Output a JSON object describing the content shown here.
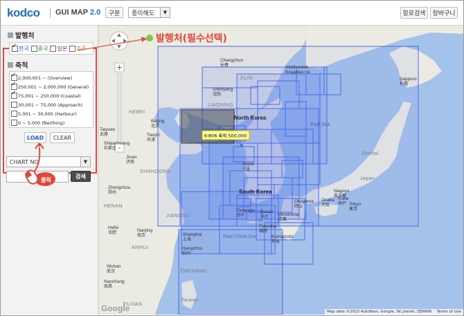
{
  "header": {
    "logo": "kodco",
    "subtitle": "GUI MAP",
    "version": "2.0",
    "category_button": "구분",
    "category_select": "종이해도",
    "route_button": "항로검색",
    "cart_button": "장바구니"
  },
  "left_panel": {
    "publisher_title": "발행처",
    "publishers": [
      {
        "label": "한국",
        "checked": true,
        "color": "#1f5fc7"
      },
      {
        "label": "중국",
        "checked": false,
        "color": "#2a8a2a"
      },
      {
        "label": "일본",
        "checked": false,
        "color": "#8a2a8a"
      },
      {
        "label": "호주",
        "checked": false,
        "color": "#c07a00"
      }
    ],
    "scale_title": "축척",
    "scales": [
      {
        "label": "2,000,001 ~ (Overview)",
        "checked": true
      },
      {
        "label": "250,001 ~ 2,000,000 (General)",
        "checked": true
      },
      {
        "label": "75,001 ~ 250,000 (Coastal)",
        "checked": true
      },
      {
        "label": "30,001 ~ 75,000 (Approach)",
        "checked": false
      },
      {
        "label": "5,001 ~ 30,000 (Harbour)",
        "checked": false
      },
      {
        "label": "0 ~ 5,000 (Berthing)",
        "checked": false
      }
    ],
    "load_button": "LOAD",
    "clear_button": "CLEAR",
    "chart_no_select": "CHART NO",
    "search_button": "검색",
    "click_label": "클릭"
  },
  "map": {
    "callout_label": "발행처(필수선택)",
    "tooltip": "K-806 축척 500,000",
    "attribution": "Map data ©2015 AutoNavi, Google, SK planet, ZENRIN",
    "terms": "Terms of Use",
    "google_logo": "Google",
    "zoom_in": "+",
    "zoom_out": "-",
    "colors": {
      "water": "#a4c2ea",
      "land": "#ecebe3",
      "chart_rect": "#4a6ae8"
    },
    "places": [
      {
        "id": "sapporo",
        "label": "Sapporo",
        "sub": "札幌"
      },
      {
        "id": "vladivostok",
        "label": "Vladivostok",
        "sub": "Владивосток"
      },
      {
        "id": "changchun",
        "label": "Changchun",
        "sub": "长春"
      },
      {
        "id": "jilin",
        "label": "JILIN",
        "sub": ""
      },
      {
        "id": "liaoning",
        "label": "LIAONING",
        "sub": ""
      },
      {
        "id": "shenyang",
        "label": "Shenyang",
        "sub": "沈阳"
      },
      {
        "id": "north_korea",
        "label": "North Korea",
        "sub": ""
      },
      {
        "id": "beijing",
        "label": "Beijing",
        "sub": "北京"
      },
      {
        "id": "tianjin",
        "label": "Tianjin",
        "sub": "天津"
      },
      {
        "id": "jinan",
        "label": "Jinan",
        "sub": "济南"
      },
      {
        "id": "shandong",
        "label": "SHANDONG",
        "sub": ""
      },
      {
        "id": "seoul",
        "label": "Seoul",
        "sub": "서울"
      },
      {
        "id": "south_korea",
        "label": "South Korea",
        "sub": ""
      },
      {
        "id": "gwangju",
        "label": "Gwangju",
        "sub": "광주"
      },
      {
        "id": "busan",
        "label": "Busan",
        "sub": "부산"
      },
      {
        "id": "fukuoka",
        "label": "Fukuoka",
        "sub": "福岡"
      },
      {
        "id": "hiroshima",
        "label": "Hiroshima",
        "sub": "広島"
      },
      {
        "id": "okayama",
        "label": "Okayama",
        "sub": "岡山"
      },
      {
        "id": "osaka",
        "label": "Osaka",
        "sub": "大阪"
      },
      {
        "id": "kobe",
        "label": "Kobe",
        "sub": "神戸"
      },
      {
        "id": "tokyo",
        "label": "Tokyo",
        "sub": "東京"
      },
      {
        "id": "nagoya",
        "label": "Nagoya",
        "sub": "名古屋"
      },
      {
        "id": "kumamoto",
        "label": "Kumamoto",
        "sub": "熊本"
      },
      {
        "id": "sendai",
        "label": "Sendai",
        "sub": ""
      },
      {
        "id": "japan",
        "label": "Japan",
        "sub": ""
      },
      {
        "id": "nanjing",
        "label": "Nanjing",
        "sub": "南京"
      },
      {
        "id": "shanghai",
        "label": "Shanghai",
        "sub": "上海"
      },
      {
        "id": "hangzhou",
        "label": "Hangzhou",
        "sub": "杭州"
      },
      {
        "id": "jiangsu",
        "label": "JIANGSU",
        "sub": ""
      },
      {
        "id": "zhejiang",
        "label": "ZHEJIANG",
        "sub": ""
      },
      {
        "id": "fujian",
        "label": "FUJIAN",
        "sub": ""
      },
      {
        "id": "hefei",
        "label": "Hefei",
        "sub": "合肥"
      },
      {
        "id": "wuhan",
        "label": "Wuhan",
        "sub": "武汉"
      },
      {
        "id": "nanchang",
        "label": "Nanchang",
        "sub": "南昌"
      },
      {
        "id": "taiwan",
        "label": "Taiwan",
        "sub": ""
      },
      {
        "id": "taiyuan",
        "label": "Taiyuan",
        "sub": "太原"
      },
      {
        "id": "shijiazhuang",
        "label": "Shijiazhuang",
        "sub": "石家庄"
      },
      {
        "id": "zhengzhou",
        "label": "Zhengzhou",
        "sub": "郑州"
      },
      {
        "id": "henan",
        "label": "HENAN",
        "sub": ""
      },
      {
        "id": "anhui",
        "label": "ANHUI",
        "sub": ""
      },
      {
        "id": "hebei",
        "label": "HEBEI",
        "sub": ""
      },
      {
        "id": "east_sea",
        "label": "East Sea",
        "sub": ""
      },
      {
        "id": "east_china_sea",
        "label": "East China Sea",
        "sub": ""
      }
    ]
  }
}
